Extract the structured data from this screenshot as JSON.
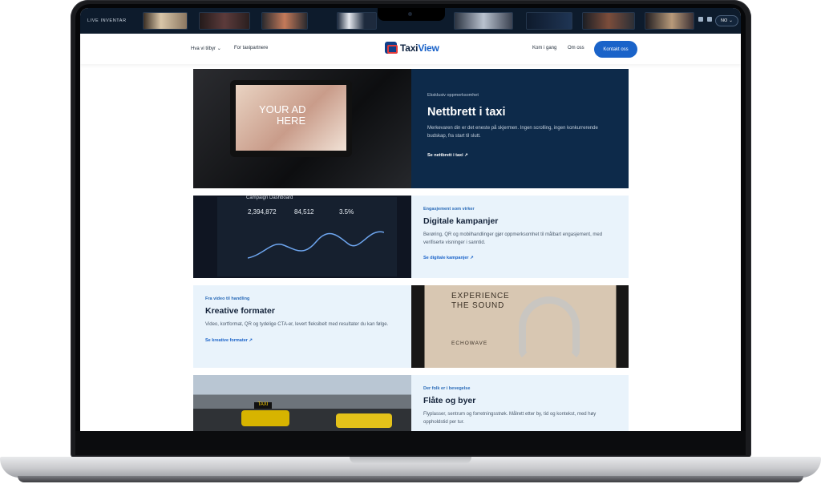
{
  "strip": {
    "label": "LIVE INVENTAR",
    "language": "NO"
  },
  "nav": {
    "services": "Hva vi tilbyr",
    "partners": "For taxipartnere",
    "brand_a": "Taxi",
    "brand_b": "View",
    "get_started": "Kom i gang",
    "about": "Om oss",
    "contact": "Kontakt oss"
  },
  "cards": [
    {
      "eyebrow": "Eksklusiv oppmerksomhet",
      "title": "Nettbrett i taxi",
      "desc": "Merkevaren din er det eneste på skjermen. Ingen scrolling, ingen konkurrerende budskap, fra start til slutt.",
      "link": "Se nettbrett i taxi",
      "image_text_1": "YOUR AD",
      "image_text_2": "HERE"
    },
    {
      "eyebrow": "Engasjement som virker",
      "title": "Digitale kampanjer",
      "desc": "Berøring, QR og mobilhandlinger gjør oppmerksomhet til målbart engasjement, med verifiserte visninger i sanntid.",
      "link": "Se digitale kampanjer",
      "dash_title": "Campaign Dashboard",
      "kpi_1": "2,394,872",
      "kpi_2": "84,512",
      "kpi_3": "3.5%"
    },
    {
      "eyebrow": "Fra video til handling",
      "title": "Kreative formater",
      "desc": "Video, kortformat, QR og tydelige CTA-er, levert fleksibelt med resultater du kan følge.",
      "link": "Se kreative formater",
      "ad_line_1": "EXPERIENCE",
      "ad_line_2": "THE SOUND",
      "ad_brand": "ECHOWAVE"
    },
    {
      "eyebrow": "Der folk er i bevegelse",
      "title": "Flåte og byer",
      "desc": "Flyplasser, sentrum og forretningsstrøk. Målrett etter by, tid og kontekst, med høy oppholdstid per tur.",
      "link": "",
      "sign": "TAXI"
    }
  ],
  "colors": {
    "dark_panel": "#0d2a4a",
    "light_panel": "#e9f3fb",
    "accent": "#1a63c9"
  }
}
